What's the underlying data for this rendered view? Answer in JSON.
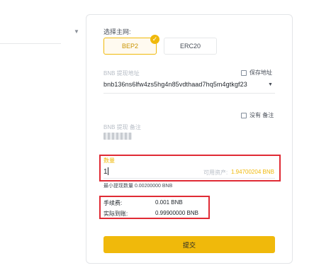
{
  "network": {
    "label": "选择主网:",
    "options": [
      {
        "label": "BEP2",
        "selected": true
      },
      {
        "label": "ERC20",
        "selected": false
      }
    ],
    "selected_check": "✓"
  },
  "address": {
    "label": "BNB 提现地址",
    "value": "bnb136ns6lfw4zs5hg4n85vdthaad7hq5m4gtkgf23",
    "save_label": "保存地址"
  },
  "memo": {
    "label": "BNB 提现 备注",
    "no_memo_label": "没有 备注"
  },
  "amount": {
    "label": "数量",
    "value": "1",
    "available_label": "可用资产:",
    "available_value": "1.94700204 BNB",
    "min_text": "最小提现数量 0.00200000 BNB"
  },
  "fees": {
    "fee_label": "手续费:",
    "fee_value": "0.001 BNB",
    "receive_label": "实际到账:",
    "receive_value": "0.99900000 BNB"
  },
  "submit_label": "提交",
  "colors": {
    "accent": "#f0b90b",
    "highlight": "#e02b35"
  }
}
